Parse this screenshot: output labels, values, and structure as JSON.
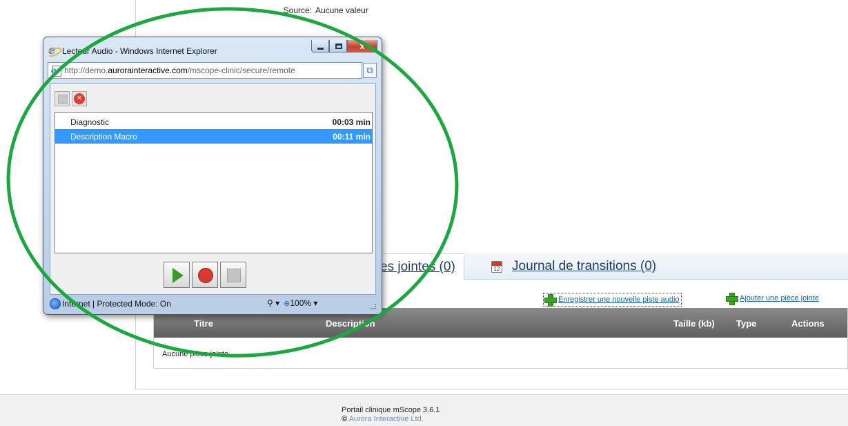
{
  "background_page": {
    "source_label": "Source:",
    "source_value": "Aucune valeur",
    "tabs": [
      {
        "label": "Pièces jointes (0)",
        "visible_label": "es jointes (0)"
      },
      {
        "label": "Journal de transitions (0)",
        "calendar_day": "12"
      }
    ],
    "actions": {
      "record_label": "Enregistrer une nouvelle piste audio",
      "attach_label": "Ajouter une pièce jointe"
    },
    "table": {
      "columns": [
        "Titre",
        "Description",
        "Taille (kb)",
        "Type",
        "Actions"
      ],
      "empty_message": "Aucune pièce jointe"
    },
    "footer": {
      "version": "Portail clinique mScope 3.6.1",
      "copyright_symbol": "©",
      "company": "Aurora Interactive Ltd."
    }
  },
  "popup": {
    "title": "Lecteur Audio - Windows Internet Explorer",
    "address": {
      "prefix": "http://demo.",
      "domain": "aurorainteractive.com",
      "path": "/mscope-clinic/secure/remote"
    },
    "tracks": [
      {
        "name": "Diagnostic",
        "duration": "00:03 min",
        "selected": false
      },
      {
        "name": "Description Macro",
        "duration": "00:11 min",
        "selected": true
      }
    ],
    "status": {
      "zone": "Internet | Protected Mode: On",
      "zoom": "100%"
    },
    "window_buttons": {
      "close_glyph": "x"
    }
  },
  "annotation": {
    "shape": "ellipse",
    "color": "#1aa83f"
  },
  "colors": {
    "selection": "#3399ff",
    "link": "#1a5fb4",
    "tab_text": "#1c3f6e",
    "table_header": "#6e6e6e"
  }
}
